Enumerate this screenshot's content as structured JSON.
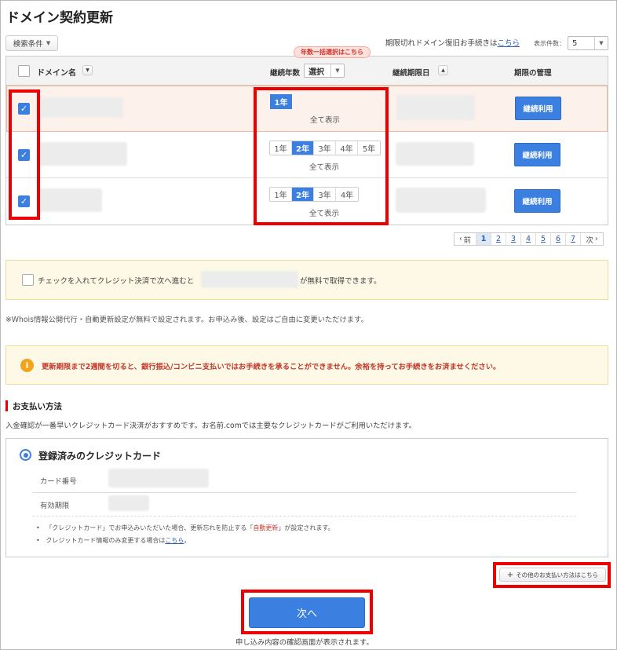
{
  "page": {
    "title": "ドメイン契約更新"
  },
  "toolbar": {
    "search_conditions": "検索条件",
    "expired_text": "期限切れドメイン復旧お手続きは",
    "expired_link": "こちら",
    "display_count_label": "表示件数：",
    "display_count_value": "5"
  },
  "table": {
    "bulk_tooltip": "年数一括選択はこちら",
    "headers": {
      "domain": "ドメイン名",
      "years": "継続年数",
      "select": "選択",
      "expiry": "継続期限日",
      "manage": "期限の管理"
    },
    "rows": [
      {
        "checked": true,
        "years": [
          "1年"
        ],
        "active": 0,
        "show_all": "全て表示",
        "action": "継続利用"
      },
      {
        "checked": true,
        "years": [
          "1年",
          "2年",
          "3年",
          "4年",
          "5年"
        ],
        "active": 1,
        "show_all": "全て表示",
        "action": "継続利用"
      },
      {
        "checked": true,
        "years": [
          "1年",
          "2年",
          "3年",
          "4年"
        ],
        "active": 1,
        "show_all": "全て表示",
        "action": "継続利用"
      }
    ]
  },
  "pagination": {
    "prev": "前",
    "pages": [
      "1",
      "2",
      "3",
      "4",
      "5",
      "6",
      "7"
    ],
    "current": "1",
    "next": "次"
  },
  "promo": {
    "text_before": "チェックを入れてクレジット決済で次へ進むと",
    "text_after": "が無料で取得できます。"
  },
  "whois_note": "※Whois情報公開代行・自動更新設定が無料で設定されます。お申込み後、設定はご自由に変更いただけます。",
  "warning": "更新期限まで2週間を切ると、銀行振込/コンビニ支払いではお手続きを承ることができません。余裕を持ってお手続きをお済ませください。",
  "payment": {
    "section_title": "お支払い方法",
    "description": "入金確認が一番早いクレジットカード決済がおすすめです。お名前.comでは主要なクレジットカードがご利用いただけます。",
    "option_label": "登録済みのクレジットカード",
    "card_number_label": "カード番号",
    "expiry_label": "有効期限",
    "note1_before": "「クレジットカード」でお申込みいただいた場合、更新忘れを防止する「",
    "note1_link": "自動更新",
    "note1_after": "」が設定されます。",
    "note2_before": "クレジットカード情報のみ変更する場合は",
    "note2_link": "こちら",
    "note2_after": "。",
    "other_methods": "その他のお支払い方法はこちら"
  },
  "footer": {
    "next_button": "次へ",
    "next_note": "申し込み内容の確認画面が表示されます。"
  },
  "colors": {
    "accent": "#3b7fe0",
    "highlight": "#ee0000",
    "warning_text": "#c0392b"
  }
}
